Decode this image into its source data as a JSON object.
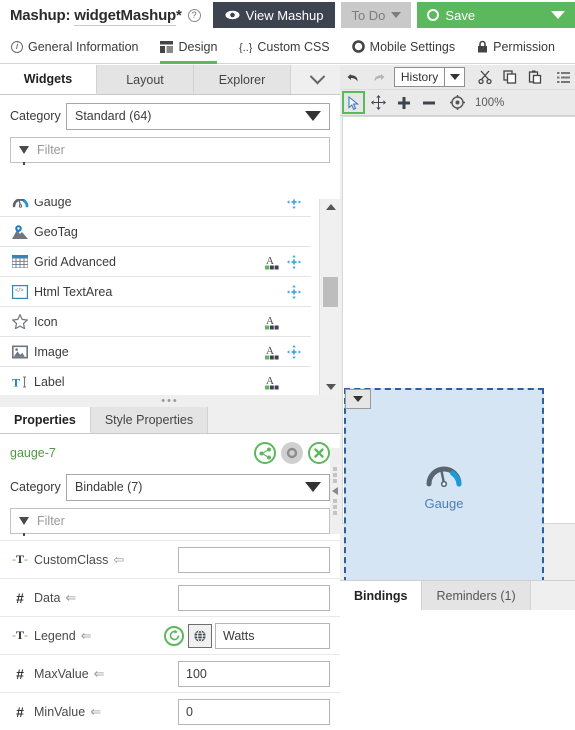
{
  "topbar": {
    "title_prefix": "Mashup:",
    "title_name": "widgetMashup",
    "dirty_marker": "*",
    "help_icon": "question-icon",
    "view_mashup_label": "View Mashup",
    "todo_label": "To Do",
    "save_label": "Save",
    "save_color": "#5cb85c",
    "view_bg": "#3d4450",
    "todo_bg": "#c9c9c9"
  },
  "navtabs": [
    {
      "label": "General Information",
      "icon": "info-icon",
      "active": false
    },
    {
      "label": "Design",
      "icon": "design-icon",
      "active": true
    },
    {
      "label": "Custom CSS",
      "icon": "braces-icon",
      "active": false
    },
    {
      "label": "Mobile Settings",
      "icon": "gear-icon",
      "active": false
    },
    {
      "label": "Permission",
      "icon": "lock-icon",
      "active": false
    }
  ],
  "left_panel": {
    "tabs": [
      {
        "label": "Widgets",
        "active": true
      },
      {
        "label": "Layout",
        "active": false
      },
      {
        "label": "Explorer",
        "active": false
      }
    ],
    "collapse_icon": "chevron-down-icon",
    "category_label": "Category",
    "category_value": "Standard (64)",
    "filter_placeholder": "Filter",
    "filter_value": "",
    "widgets": [
      {
        "name": "Gauge",
        "icon": "gauge-icon",
        "has_style": false,
        "has_move": true
      },
      {
        "name": "GeoTag",
        "icon": "geotag-icon",
        "has_style": false,
        "has_move": false
      },
      {
        "name": "Grid Advanced",
        "icon": "grid-icon",
        "has_style": true,
        "has_move": true
      },
      {
        "name": "Html TextArea",
        "icon": "html-icon",
        "has_style": false,
        "has_move": true
      },
      {
        "name": "Icon",
        "icon": "star-icon",
        "has_style": true,
        "has_move": false
      },
      {
        "name": "Image",
        "icon": "image-icon",
        "has_style": true,
        "has_move": true
      },
      {
        "name": "Label",
        "icon": "label-text-icon",
        "has_style": true,
        "has_move": false
      }
    ]
  },
  "properties_panel": {
    "tabs": [
      {
        "label": "Properties",
        "active": true
      },
      {
        "label": "Style Properties",
        "active": false
      }
    ],
    "widget_id": "gauge-7",
    "widget_id_color": "#4f9a41",
    "actions": [
      {
        "name": "share-icon",
        "enabled": true
      },
      {
        "name": "gear-icon",
        "enabled": false
      },
      {
        "name": "close-icon",
        "enabled": true
      }
    ],
    "category_label": "Category",
    "category_value": "Bindable (7)",
    "filter_placeholder": "Filter",
    "filter_value": "",
    "rows": [
      {
        "type": "string",
        "type_glyph": "-T-",
        "name": "CustomClass",
        "binding": "two-way",
        "value": "",
        "has_refresh": false,
        "has_localize": false
      },
      {
        "type": "number",
        "type_glyph": "#",
        "name": "Data",
        "binding": "in",
        "value": "",
        "has_refresh": false,
        "has_localize": false
      },
      {
        "type": "string",
        "type_glyph": "-T-",
        "name": "Legend",
        "binding": "in",
        "value": "Watts",
        "has_refresh": true,
        "has_localize": true
      },
      {
        "type": "number",
        "type_glyph": "#",
        "name": "MaxValue",
        "binding": "in",
        "value": "100",
        "has_refresh": false,
        "has_localize": false
      },
      {
        "type": "number",
        "type_glyph": "#",
        "name": "MinValue",
        "binding": "in",
        "value": "0",
        "has_refresh": false,
        "has_localize": false
      }
    ]
  },
  "design_area": {
    "toolbar_row1": [
      {
        "name": "undo-icon",
        "disabled": false
      },
      {
        "name": "redo-icon",
        "disabled": true
      }
    ],
    "history_label": "History",
    "history_caret": "caret-down-icon",
    "toolbar_clipboard": [
      {
        "name": "cut-icon"
      },
      {
        "name": "copy-icon"
      },
      {
        "name": "paste-icon"
      },
      {
        "name": "list-icon"
      }
    ],
    "toolbar_row2": [
      {
        "name": "select-arrow-icon",
        "selected": true
      },
      {
        "name": "pan-move-icon",
        "selected": false
      },
      {
        "name": "zoom-in-icon",
        "selected": false
      },
      {
        "name": "zoom-out-icon",
        "selected": false
      },
      {
        "name": "zoom-reset-icon",
        "selected": false
      }
    ],
    "zoom_level": "100%",
    "widget": {
      "label": "Gauge",
      "icon": "gauge-icon",
      "selected": true,
      "fill_color": "#d6e5f3",
      "border_color": "#2c5f9e",
      "label_color": "#4a7fb5",
      "handle_icon": "caret-down-icon"
    },
    "bottom_tabs": [
      {
        "label": "Bindings",
        "active": true
      },
      {
        "label": "Reminders (1)",
        "active": false
      }
    ]
  }
}
